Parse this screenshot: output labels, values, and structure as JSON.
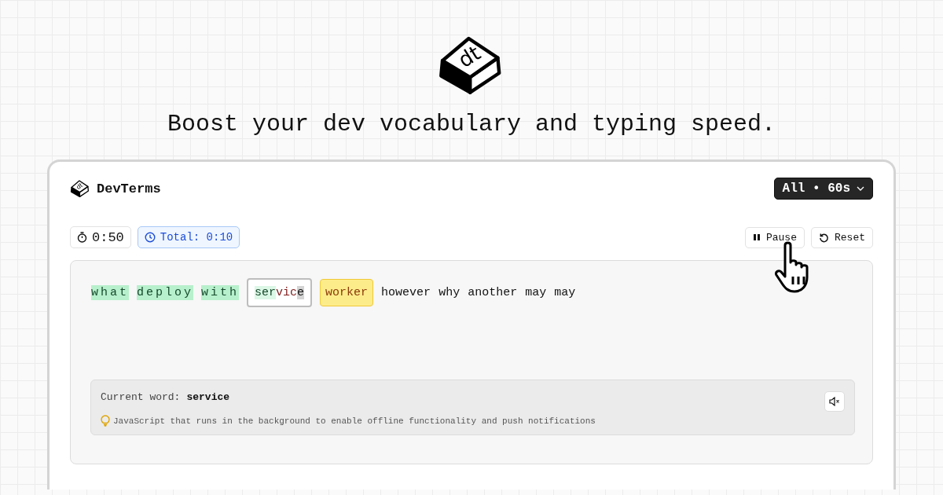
{
  "hero": {
    "logo_text": "dt",
    "headline": "Boost your dev vocabulary and typing speed."
  },
  "app": {
    "logo_text": "dt",
    "name": "DevTerms",
    "mode_menu": "All • 60s",
    "timer": "0:50",
    "total": "Total: 0:10",
    "buttons": [
      {
        "kind": "pause",
        "label": "Pause"
      },
      {
        "kind": "reset",
        "label": "Reset"
      }
    ],
    "words": [
      {
        "kind": "correct",
        "text": "what"
      },
      {
        "kind": "correct",
        "text": "deploy"
      },
      {
        "kind": "correct",
        "text": "with"
      },
      {
        "kind": "current",
        "segments": [
          {
            "kind": "correct",
            "text": "ser"
          },
          {
            "kind": "wrong",
            "text": "vic"
          },
          {
            "kind": "cursor",
            "text": "e"
          }
        ]
      },
      {
        "kind": "next",
        "text": "worker"
      },
      {
        "kind": "pending",
        "text": "however"
      },
      {
        "kind": "pending",
        "text": "why"
      },
      {
        "kind": "pending",
        "text": "another"
      },
      {
        "kind": "pending",
        "text": "may"
      },
      {
        "kind": "pending",
        "text": "may"
      }
    ],
    "hint": {
      "label": "Current word:",
      "word": "service",
      "definition": "JavaScript that runs in the background to enable offline functionality and push notifications",
      "muted": true
    }
  }
}
